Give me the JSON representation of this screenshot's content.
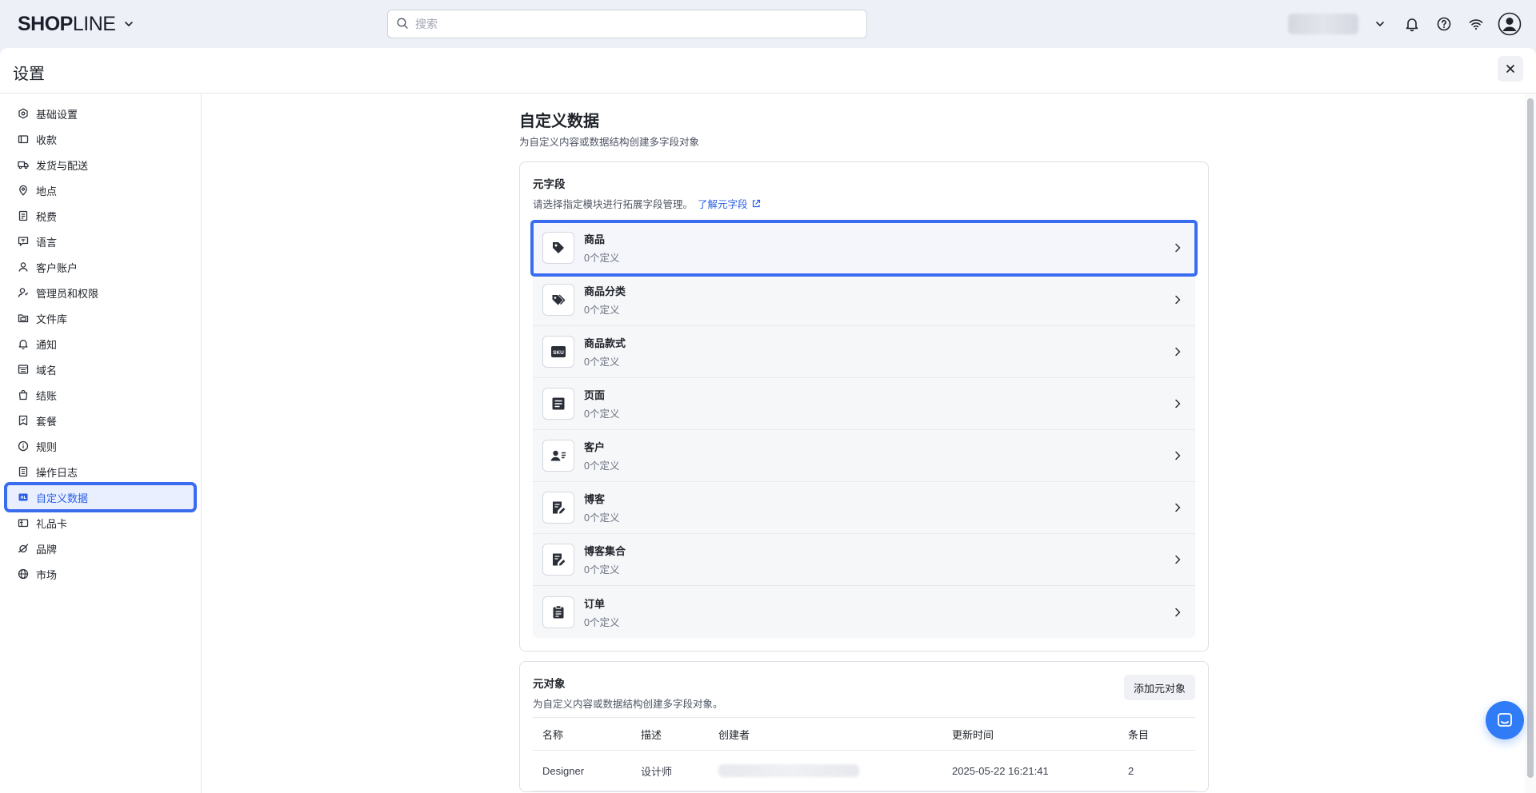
{
  "brand": {
    "logo_bold": "SHOP",
    "logo_light": "LINE"
  },
  "search": {
    "placeholder": "搜索"
  },
  "panel": {
    "title": "设置"
  },
  "sidebar": {
    "items": [
      {
        "label": "基础设置",
        "icon": "settings-icon"
      },
      {
        "label": "收款",
        "icon": "payment-icon"
      },
      {
        "label": "发货与配送",
        "icon": "truck-icon"
      },
      {
        "label": "地点",
        "icon": "location-icon"
      },
      {
        "label": "税费",
        "icon": "tax-icon"
      },
      {
        "label": "语言",
        "icon": "language-icon"
      },
      {
        "label": "客户账户",
        "icon": "user-icon"
      },
      {
        "label": "管理员和权限",
        "icon": "admin-icon"
      },
      {
        "label": "文件库",
        "icon": "folder-icon"
      },
      {
        "label": "通知",
        "icon": "bell-icon"
      },
      {
        "label": "域名",
        "icon": "domain-icon"
      },
      {
        "label": "结账",
        "icon": "bag-icon"
      },
      {
        "label": "套餐",
        "icon": "plan-icon"
      },
      {
        "label": "规则",
        "icon": "info-icon"
      },
      {
        "label": "操作日志",
        "icon": "log-icon"
      },
      {
        "label": "自定义数据",
        "icon": "custom-data-icon",
        "active": true
      },
      {
        "label": "礼品卡",
        "icon": "gift-card-icon"
      },
      {
        "label": "品牌",
        "icon": "brand-icon"
      },
      {
        "label": "市场",
        "icon": "globe-icon"
      }
    ]
  },
  "page": {
    "title": "自定义数据",
    "subtitle": "为自定义内容或数据结构创建多字段对象"
  },
  "metafields": {
    "title": "元字段",
    "subtitle": "请选择指定模块进行拓展字段管理。",
    "learn_link": "了解元字段",
    "items": [
      {
        "name": "商品",
        "count": "0个定义",
        "icon": "tag-icon"
      },
      {
        "name": "商品分类",
        "count": "0个定义",
        "icon": "tags-icon"
      },
      {
        "name": "商品款式",
        "count": "0个定义",
        "icon": "sku-icon",
        "icon_text": "SKU"
      },
      {
        "name": "页面",
        "count": "0个定义",
        "icon": "page-icon"
      },
      {
        "name": "客户",
        "count": "0个定义",
        "icon": "customer-icon"
      },
      {
        "name": "博客",
        "count": "0个定义",
        "icon": "blog-icon"
      },
      {
        "name": "博客集合",
        "count": "0个定义",
        "icon": "blog-collection-icon"
      },
      {
        "name": "订单",
        "count": "0个定义",
        "icon": "order-icon"
      }
    ]
  },
  "metaobjects": {
    "title": "元对象",
    "subtitle": "为自定义内容或数据结构创建多字段对象。",
    "add_button": "添加元对象",
    "columns": [
      "名称",
      "描述",
      "创建者",
      "更新时间",
      "条目"
    ],
    "rows": [
      {
        "name": "Designer",
        "description": "设计师",
        "creator": "",
        "updated": "2025-05-22 16:21:41",
        "entries": "2"
      }
    ]
  },
  "colors": {
    "accent": "#2a5ee5",
    "highlight": "#3a6cf0",
    "chat": "#2f7cf6"
  }
}
